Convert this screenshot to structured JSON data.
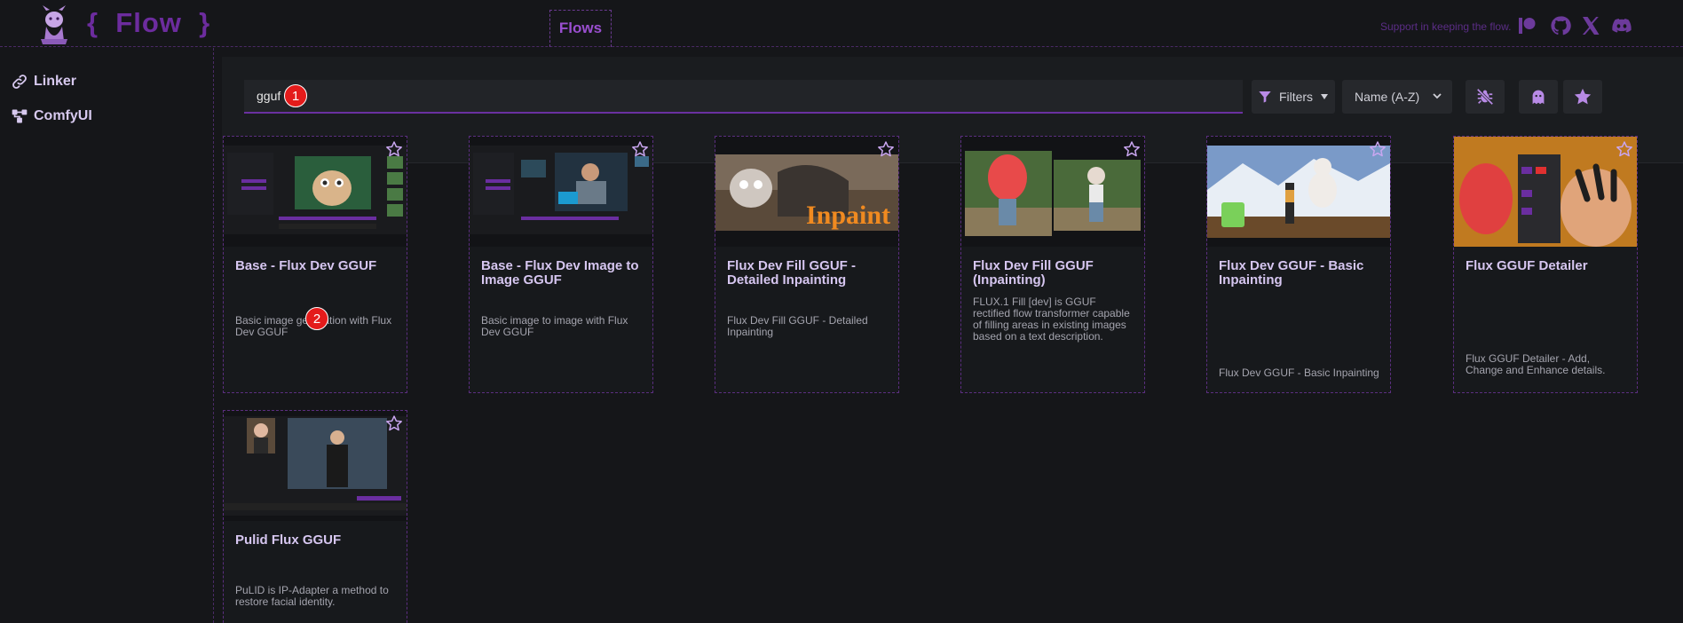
{
  "header": {
    "brand": "{  Flow  }",
    "nav_tab": "Flows",
    "support_text": "Support in keeping the flow.",
    "social_icons": [
      "patreon-icon",
      "github-icon",
      "x-icon",
      "discord-icon"
    ]
  },
  "sidebar": {
    "items": [
      {
        "label": "Linker",
        "icon": "link-icon"
      },
      {
        "label": "ComfyUI",
        "icon": "nodes-icon"
      }
    ]
  },
  "toolbar": {
    "search_value": "gguf",
    "filters_label": "Filters",
    "sort_value": "Name (A-Z)",
    "icon_buttons": [
      "bug-off-icon",
      "ghost-icon",
      "star-icon"
    ]
  },
  "annotations": [
    "1",
    "2"
  ],
  "cards": [
    {
      "title": "Base - Flux Dev GGUF",
      "description": "Basic image generation with Flux Dev GGUF"
    },
    {
      "title": "Base - Flux Dev Image to Image GGUF",
      "description": "Basic image to image with Flux Dev GGUF"
    },
    {
      "title": "Flux Dev Fill GGUF - Detailed Inpainting",
      "description": "Flux Dev Fill GGUF - Detailed Inpainting"
    },
    {
      "title": "Flux Dev Fill GGUF (Inpainting)",
      "description": "FLUX.1 Fill [dev] is GGUF rectified flow transformer capable of filling areas in existing images based on a text description."
    },
    {
      "title": "Flux Dev GGUF - Basic Inpainting",
      "description": "Flux Dev GGUF - Basic Inpainting"
    },
    {
      "title": "Flux GGUF Detailer",
      "description": "Flux GGUF Detailer - Add, Change and Enhance details."
    },
    {
      "title": "Pulid Flux GGUF",
      "description": "PuLID is IP-Adapter a method to restore facial identity."
    }
  ],
  "thumb_text": {
    "inpaint_word": "Inpaint"
  },
  "colors": {
    "accent": "#6c2c9e",
    "card_border": "#5b2e80",
    "badge": "#e41b1b"
  }
}
